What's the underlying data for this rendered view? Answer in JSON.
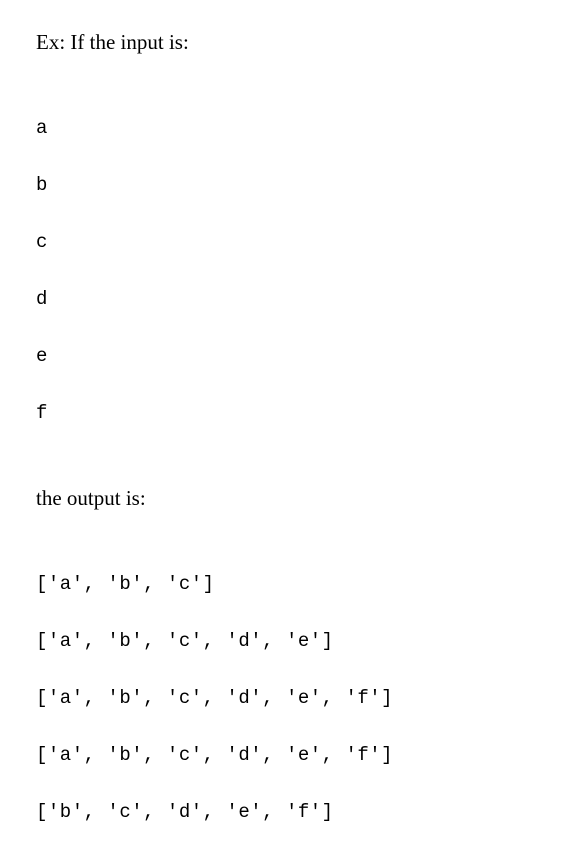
{
  "intro": "Ex: If the input is:",
  "input_lines": [
    "a",
    "b",
    "c",
    "d",
    "e",
    "f"
  ],
  "mid": "the output is:",
  "output_lines": [
    "['a', 'b', 'c']",
    "['a', 'b', 'c', 'd', 'e']",
    "['a', 'b', 'c', 'd', 'e', 'f']",
    "['a', 'b', 'c', 'd', 'e', 'f']",
    "['b', 'c', 'd', 'e', 'f']"
  ]
}
